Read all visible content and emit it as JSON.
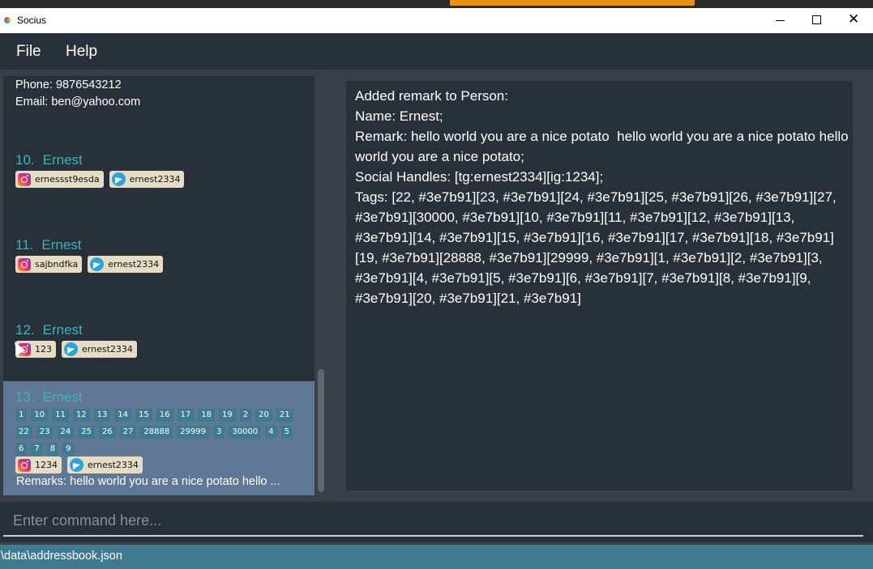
{
  "window": {
    "title": "Socius"
  },
  "menu": {
    "file": "File",
    "help": "Help"
  },
  "person_list": {
    "partial": {
      "phone": "Phone: 9876543212",
      "email": "Email: ben@yahoo.com"
    },
    "cards": [
      {
        "index": "10.",
        "name": "Ernest",
        "ig": "ernessst9esda",
        "tg": "ernest2334"
      },
      {
        "index": "11.",
        "name": "Ernest",
        "ig": "sajbndfka",
        "tg": "ernest2334"
      },
      {
        "index": "12.",
        "name": "Ernest",
        "ig": "123",
        "tg": "ernest2334"
      }
    ],
    "selected": {
      "index": "13.",
      "name": "Ernest",
      "tags": [
        "1",
        "10",
        "11",
        "12",
        "13",
        "14",
        "15",
        "16",
        "17",
        "18",
        "19",
        "2",
        "20",
        "21",
        "22",
        "23",
        "24",
        "25",
        "26",
        "27",
        "28888",
        "29999",
        "3",
        "30000",
        "4",
        "5",
        "6",
        "7",
        "8",
        "9"
      ],
      "ig": "1234",
      "tg": "ernest2334",
      "remarks": "Remarks: hello world you are a nice potato  hello ..."
    }
  },
  "result": {
    "text": "Added remark to Person:\nName: Ernest;\nRemark: hello world you are a nice potato  hello world you are a nice potato hello world you are a nice potato;\nSocial Handles: [tg:ernest2334][ig:1234];\nTags: [22, #3e7b91][23, #3e7b91][24, #3e7b91][25, #3e7b91][26, #3e7b91][27, #3e7b91][30000, #3e7b91][10, #3e7b91][11, #3e7b91][12, #3e7b91][13, #3e7b91][14, #3e7b91][15, #3e7b91][16, #3e7b91][17, #3e7b91][18, #3e7b91][19, #3e7b91][28888, #3e7b91][29999, #3e7b91][1, #3e7b91][2, #3e7b91][3, #3e7b91][4, #3e7b91][5, #3e7b91][6, #3e7b91][7, #3e7b91][8, #3e7b91][9, #3e7b91][20, #3e7b91][21, #3e7b91]"
  },
  "command": {
    "placeholder": "Enter command here...",
    "value": ""
  },
  "status": {
    "path": "\\data\\addressbook.json"
  },
  "colors": {
    "accent": "#3e7b91",
    "name": "#3bb5b9",
    "selected": "#5f7895",
    "panel": "#283039",
    "background": "#383f49"
  },
  "icons": {
    "instagram": "instagram-icon",
    "telegram": "telegram-icon"
  }
}
